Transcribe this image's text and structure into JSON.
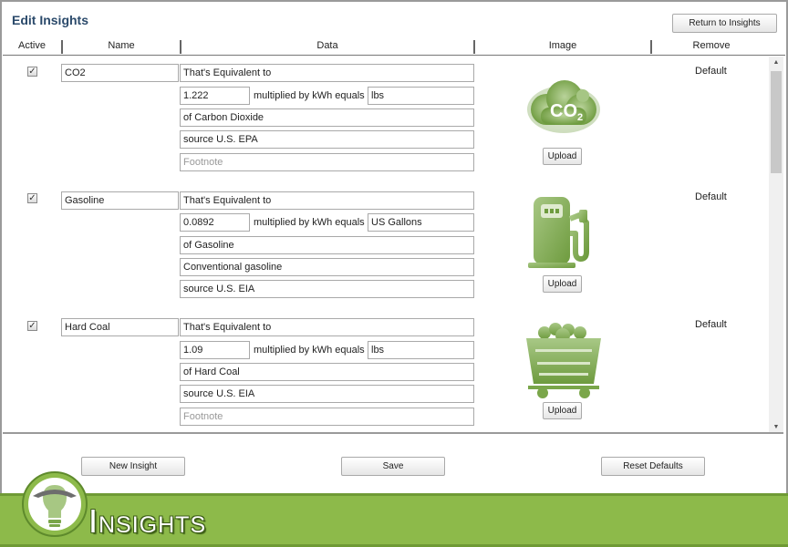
{
  "page": {
    "title": "Edit Insights",
    "return_label": "Return to Insights"
  },
  "columns": {
    "active": "Active",
    "name": "Name",
    "data": "Data",
    "image": "Image",
    "remove": "Remove"
  },
  "insights": [
    {
      "active": true,
      "name": "CO2",
      "equivalent": "That's Equivalent to",
      "factor": "1.222",
      "multiplied_label": "multiplied by kWh equals",
      "unit": "lbs",
      "description": "of Carbon Dioxide",
      "source": "source U.S. EPA",
      "footnote": "",
      "footnote_placeholder": "Footnote",
      "icon": "co2-cloud-icon",
      "upload_label": "Upload",
      "remove": "Default"
    },
    {
      "active": true,
      "name": "Gasoline",
      "equivalent": "That's Equivalent to",
      "factor": "0.0892",
      "multiplied_label": "multiplied by kWh equals",
      "unit": "US Gallons",
      "description": "of Gasoline",
      "source": "Conventional gasoline",
      "footnote": "source U.S. EIA",
      "footnote_placeholder": "Footnote",
      "icon": "gas-pump-icon",
      "upload_label": "Upload",
      "remove": "Default"
    },
    {
      "active": true,
      "name": "Hard Coal",
      "equivalent": "That's Equivalent to",
      "factor": "1.09",
      "multiplied_label": "multiplied by kWh equals",
      "unit": "lbs",
      "description": "of Hard Coal",
      "source": "source U.S. EIA",
      "footnote": "",
      "footnote_placeholder": "Footnote",
      "icon": "coal-cart-icon",
      "upload_label": "Upload",
      "remove": "Default"
    }
  ],
  "actions": {
    "new_label": "New Insight",
    "save_label": "Save",
    "reset_label": "Reset Defaults"
  },
  "banner": {
    "title": "Insights",
    "icon": "lightbulb-logo-icon"
  },
  "colors": {
    "accent_green": "#8dba4a",
    "icon_green": "#7aa64a",
    "title_blue": "#2b4a6b"
  }
}
